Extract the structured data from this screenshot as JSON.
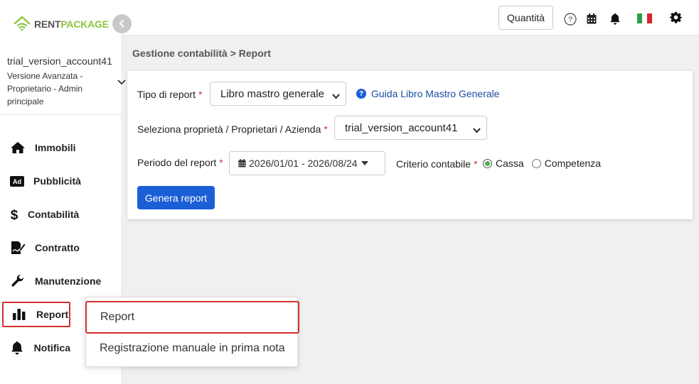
{
  "app": {
    "logo_rent": "RENT",
    "logo_package": "PACKAGE"
  },
  "account": {
    "name": "trial_version_account41",
    "role": "Versione Avanzata - Proprietario - Admin principale"
  },
  "nav": {
    "items": [
      {
        "label": "Immobili",
        "icon": "home-icon"
      },
      {
        "label": "Pubblicità",
        "icon": "ad-icon"
      },
      {
        "label": "Contabilità",
        "icon": "dollar-icon"
      },
      {
        "label": "Contratto",
        "icon": "contract-icon"
      },
      {
        "label": "Manutenzione",
        "icon": "wrench-icon"
      },
      {
        "label": "Report",
        "icon": "bar-chart-icon"
      },
      {
        "label": "Notifica",
        "icon": "bell-icon"
      }
    ]
  },
  "topbar": {
    "quantity_label": "Quantità",
    "icons": [
      "help-icon",
      "calendar-icon",
      "bell-icon",
      "italy-flag-icon",
      "gear-icon"
    ]
  },
  "breadcrumb": "Gestione contabilità > Report",
  "form": {
    "report_type_label": "Tipo di report",
    "report_type_value": "Libro mastro generale",
    "guide_link": "Guida Libro Mastro Generale",
    "property_label": "Seleziona proprietà / Proprietari / Azienda",
    "property_value": "trial_version_account41",
    "period_label": "Periodo del report",
    "period_value": "2026/01/01 - 2026/08/24",
    "criterion_label": "Criterio contabile",
    "option_cassa": "Cassa",
    "option_competenza": "Competenza",
    "selected_criterion": "Cassa",
    "required_mark": "*",
    "generate_button": "Genera report"
  },
  "submenu": {
    "items": [
      "Report",
      "Registrazione manuale in prima nota"
    ]
  },
  "colors": {
    "accent": "#1a5fd6",
    "brand_green": "#8cc63f",
    "highlight_red": "#d32f2f"
  }
}
